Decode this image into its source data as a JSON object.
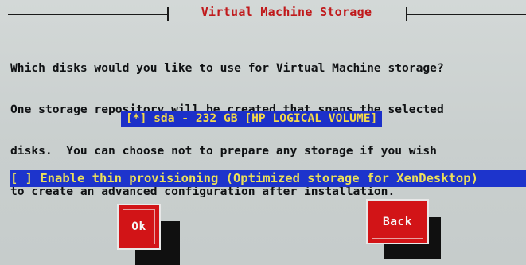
{
  "dialog": {
    "title": "Virtual Machine Storage",
    "description_lines": [
      "Which disks would you like to use for Virtual Machine storage?",
      "One storage repository will be created that spans the selected",
      "disks.  You can choose not to prepare any storage if you wish",
      "to create an advanced configuration after installation."
    ]
  },
  "disks": [
    {
      "label": "[*] sda - 232 GB [HP LOGICAL VOLUME]",
      "selected": true
    }
  ],
  "options": {
    "thin_provisioning_label": "[ ] Enable thin provisioning (Optimized storage for XenDesktop)",
    "thin_provisioning_checked": false
  },
  "buttons": {
    "ok_label": "Ok",
    "back_label": "Back"
  },
  "colors": {
    "background": "#cfd4d3",
    "title": "#c0191b",
    "highlight_bg": "#1c30c9",
    "highlight_text": "#f3d84a",
    "button_bg": "#d21417"
  }
}
